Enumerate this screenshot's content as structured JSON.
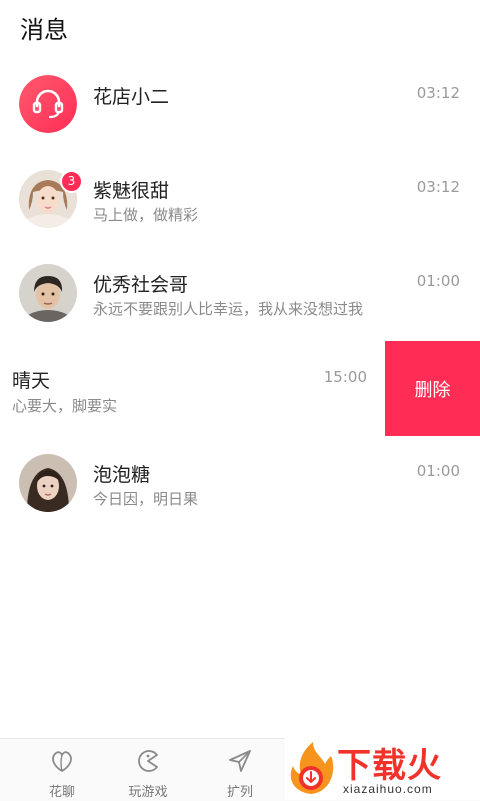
{
  "header": {
    "title": "消息"
  },
  "conversations": [
    {
      "name": "花店小二",
      "preview": "",
      "time": "03:12",
      "avatar": "customer-service-icon"
    },
    {
      "name": "紫魅很甜",
      "preview": "马上做，做精彩",
      "time": "03:12",
      "badge": "3",
      "avatar": "girl-photo"
    },
    {
      "name": "优秀社会哥",
      "preview": "永远不要跟别人比幸运，我从来没想过我",
      "time": "01:00",
      "avatar": "man-photo"
    },
    {
      "name": "晴天",
      "preview": "心要大，脚要实",
      "time": "15:00",
      "swiped": true,
      "delete_label": "删除"
    },
    {
      "name": "泡泡糖",
      "preview": "今日因，明日果",
      "time": "01:00",
      "avatar": "woman-photo"
    }
  ],
  "tabbar": {
    "tabs": [
      {
        "label": "花聊",
        "icon": "heart-leaf-icon"
      },
      {
        "label": "玩游戏",
        "icon": "pacman-icon"
      },
      {
        "label": "扩列",
        "icon": "send-icon"
      }
    ]
  },
  "watermark": {
    "text": "下载火",
    "sub": "xiazaihuo.com"
  },
  "colors": {
    "accent": "#ff2d55",
    "watermark": "#f0322a"
  }
}
